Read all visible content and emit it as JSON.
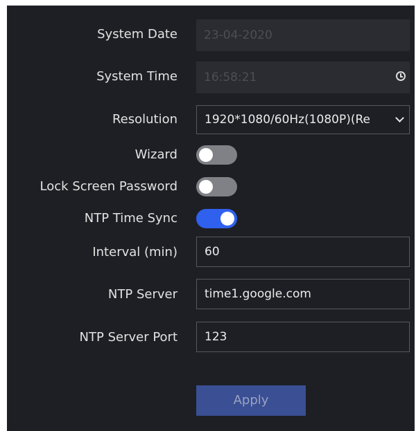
{
  "settings": {
    "system_date": {
      "label": "System Date",
      "value": "23-04-2020"
    },
    "system_time": {
      "label": "System Time",
      "value": "16:58:21",
      "icon": "clock-icon"
    },
    "resolution": {
      "label": "Resolution",
      "value": "1920*1080/60Hz(1080P)(Re",
      "icon": "chevron-down-icon"
    },
    "wizard": {
      "label": "Wizard",
      "enabled": false
    },
    "lock_screen_password": {
      "label": "Lock Screen Password",
      "enabled": false
    },
    "ntp_time_sync": {
      "label": "NTP Time Sync",
      "enabled": true
    },
    "interval": {
      "label": "Interval (min)",
      "value": "60"
    },
    "ntp_server": {
      "label": "NTP Server",
      "value": "time1.google.com"
    },
    "ntp_server_port": {
      "label": "NTP Server Port",
      "value": "123"
    }
  },
  "apply_button": {
    "label": "Apply"
  },
  "colors": {
    "panel_background": "#1e1f24",
    "toggle_on": "#2f61ee",
    "toggle_off": "#808187",
    "apply_button": "#3a4f94"
  }
}
